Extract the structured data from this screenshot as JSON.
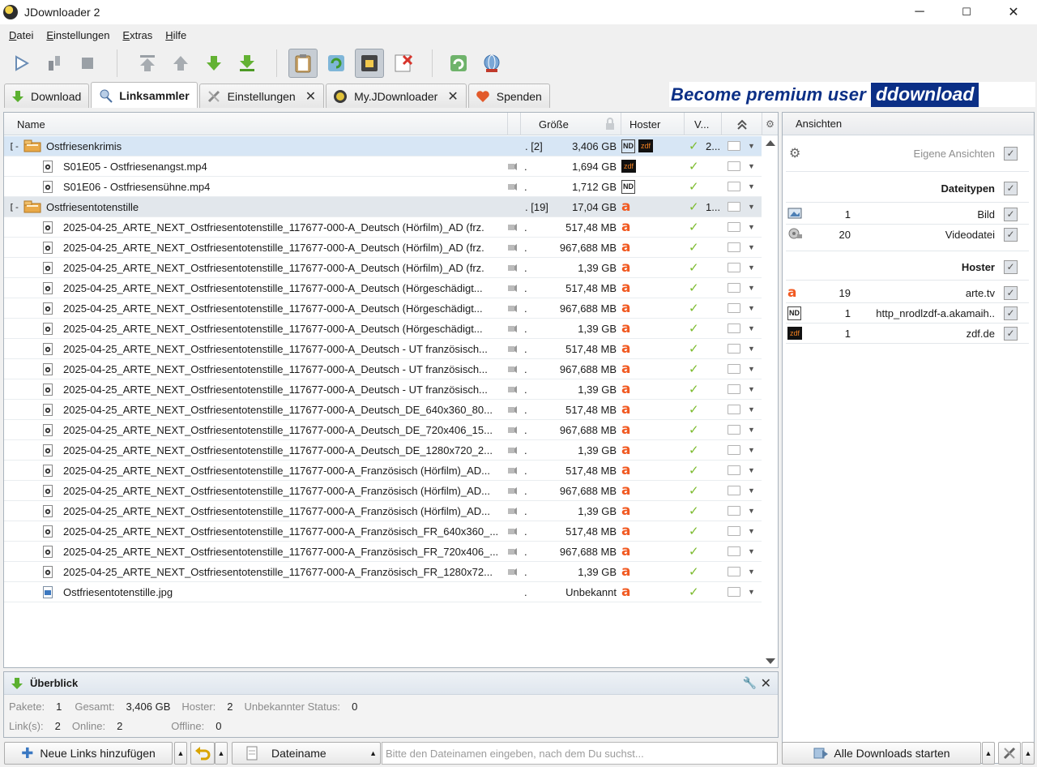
{
  "window": {
    "title": "JDownloader 2",
    "minimize": "─",
    "maximize": "☐",
    "close": "✕"
  },
  "menu": [
    "Datei",
    "Einstellungen",
    "Extras",
    "Hilfe"
  ],
  "tabs": [
    {
      "label": "Download",
      "closable": false
    },
    {
      "label": "Linksammler",
      "closable": false,
      "active": true
    },
    {
      "label": "Einstellungen",
      "closable": true
    },
    {
      "label": "My.JDownloader",
      "closable": true
    },
    {
      "label": "Spenden",
      "closable": false
    }
  ],
  "banner": {
    "text": "Become premium user",
    "logo": "ddownload"
  },
  "table": {
    "columns": {
      "name": "Name",
      "size": "Größe",
      "hoster": "Hoster",
      "avail": "V...",
      "settings_icon": "gear-icon"
    },
    "packages": [
      {
        "name": "Ostfriesenkrimis",
        "expand": "[-]",
        "count": "[2]",
        "size": "3,406 GB",
        "hosters": [
          "nd",
          "zdf"
        ],
        "avail": "2...",
        "links": [
          {
            "name": "S01E05 - Ostfriesenangst.mp4",
            "size": "1,694 GB",
            "hoster": "zdf"
          },
          {
            "name": "S01E06 - Ostfriesensühne.mp4",
            "size": "1,712 GB",
            "hoster": "nd"
          }
        ]
      },
      {
        "name": "Ostfriesentotenstille",
        "expand": "[-]",
        "count": "[19]",
        "size": "17,04 GB",
        "hosters": [
          "arte"
        ],
        "avail": "1...",
        "links": [
          {
            "name": "2025-04-25_ARTE_NEXT_Ostfriesentotenstille_117677-000-A_Deutsch (Hörfilm)_AD (frz.",
            "size": "517,48 MB",
            "hoster": "arte"
          },
          {
            "name": "2025-04-25_ARTE_NEXT_Ostfriesentotenstille_117677-000-A_Deutsch (Hörfilm)_AD (frz.",
            "size": "967,688 MB",
            "hoster": "arte"
          },
          {
            "name": "2025-04-25_ARTE_NEXT_Ostfriesentotenstille_117677-000-A_Deutsch (Hörfilm)_AD (frz.",
            "size": "1,39 GB",
            "hoster": "arte"
          },
          {
            "name": "2025-04-25_ARTE_NEXT_Ostfriesentotenstille_117677-000-A_Deutsch (Hörgeschädigt...",
            "size": "517,48 MB",
            "hoster": "arte"
          },
          {
            "name": "2025-04-25_ARTE_NEXT_Ostfriesentotenstille_117677-000-A_Deutsch (Hörgeschädigt...",
            "size": "967,688 MB",
            "hoster": "arte"
          },
          {
            "name": "2025-04-25_ARTE_NEXT_Ostfriesentotenstille_117677-000-A_Deutsch (Hörgeschädigt...",
            "size": "1,39 GB",
            "hoster": "arte"
          },
          {
            "name": "2025-04-25_ARTE_NEXT_Ostfriesentotenstille_117677-000-A_Deutsch - UT französisch...",
            "size": "517,48 MB",
            "hoster": "arte"
          },
          {
            "name": "2025-04-25_ARTE_NEXT_Ostfriesentotenstille_117677-000-A_Deutsch - UT französisch...",
            "size": "967,688 MB",
            "hoster": "arte"
          },
          {
            "name": "2025-04-25_ARTE_NEXT_Ostfriesentotenstille_117677-000-A_Deutsch - UT französisch...",
            "size": "1,39 GB",
            "hoster": "arte"
          },
          {
            "name": "2025-04-25_ARTE_NEXT_Ostfriesentotenstille_117677-000-A_Deutsch_DE_640x360_80...",
            "size": "517,48 MB",
            "hoster": "arte"
          },
          {
            "name": "2025-04-25_ARTE_NEXT_Ostfriesentotenstille_117677-000-A_Deutsch_DE_720x406_15...",
            "size": "967,688 MB",
            "hoster": "arte"
          },
          {
            "name": "2025-04-25_ARTE_NEXT_Ostfriesentotenstille_117677-000-A_Deutsch_DE_1280x720_2...",
            "size": "1,39 GB",
            "hoster": "arte"
          },
          {
            "name": "2025-04-25_ARTE_NEXT_Ostfriesentotenstille_117677-000-A_Französisch (Hörfilm)_AD...",
            "size": "517,48 MB",
            "hoster": "arte"
          },
          {
            "name": "2025-04-25_ARTE_NEXT_Ostfriesentotenstille_117677-000-A_Französisch (Hörfilm)_AD...",
            "size": "967,688 MB",
            "hoster": "arte"
          },
          {
            "name": "2025-04-25_ARTE_NEXT_Ostfriesentotenstille_117677-000-A_Französisch (Hörfilm)_AD...",
            "size": "1,39 GB",
            "hoster": "arte"
          },
          {
            "name": "2025-04-25_ARTE_NEXT_Ostfriesentotenstille_117677-000-A_Französisch_FR_640x360_...",
            "size": "517,48 MB",
            "hoster": "arte"
          },
          {
            "name": "2025-04-25_ARTE_NEXT_Ostfriesentotenstille_117677-000-A_Französisch_FR_720x406_...",
            "size": "967,688 MB",
            "hoster": "arte"
          },
          {
            "name": "2025-04-25_ARTE_NEXT_Ostfriesentotenstille_117677-000-A_Französisch_FR_1280x72...",
            "size": "1,39 GB",
            "hoster": "arte"
          },
          {
            "name": "Ostfriesentotenstille.jpg",
            "size": "Unbekannt",
            "hoster": "arte",
            "type": "image"
          }
        ]
      }
    ]
  },
  "side": {
    "header": "Ansichten",
    "custom_views": "Eigene Ansichten",
    "filetypes_header": "Dateitypen",
    "filetypes": [
      {
        "count": "1",
        "label": "Bild"
      },
      {
        "count": "20",
        "label": "Videodatei"
      }
    ],
    "hosters_header": "Hoster",
    "hosters": [
      {
        "count": "19",
        "label": "arte.tv",
        "icon": "arte"
      },
      {
        "count": "1",
        "label": "http_nrodlzdf-a.akamaih..",
        "icon": "nd"
      },
      {
        "count": "1",
        "label": "zdf.de",
        "icon": "zdf"
      }
    ]
  },
  "overview": {
    "title": "Überblick",
    "line1": [
      {
        "k": "Pakete:",
        "v": "1"
      },
      {
        "k": "Gesamt:",
        "v": "3,406 GB"
      },
      {
        "k": "Hoster:",
        "v": "2"
      },
      {
        "k": "Unbekannter Status:",
        "v": "0"
      }
    ],
    "line2": [
      {
        "k": "Link(s):",
        "v": "2"
      },
      {
        "k": "Online:",
        "v": "2"
      },
      {
        "k": "Offline:",
        "v": "0"
      }
    ]
  },
  "bottom": {
    "add_links": "Neue Links hinzufügen",
    "search_field": "Dateiname",
    "search_placeholder": "Bitte den Dateinamen eingeben, nach dem Du suchst...",
    "start_all": "Alle Downloads starten"
  },
  "colors": {
    "accent_blue": "#0b2f86",
    "arte_orange": "#f15a22",
    "check_green": "#7cbb2e",
    "pkg1_bg": "#d7e6f5",
    "pkg2_bg": "#e2e7ec"
  }
}
